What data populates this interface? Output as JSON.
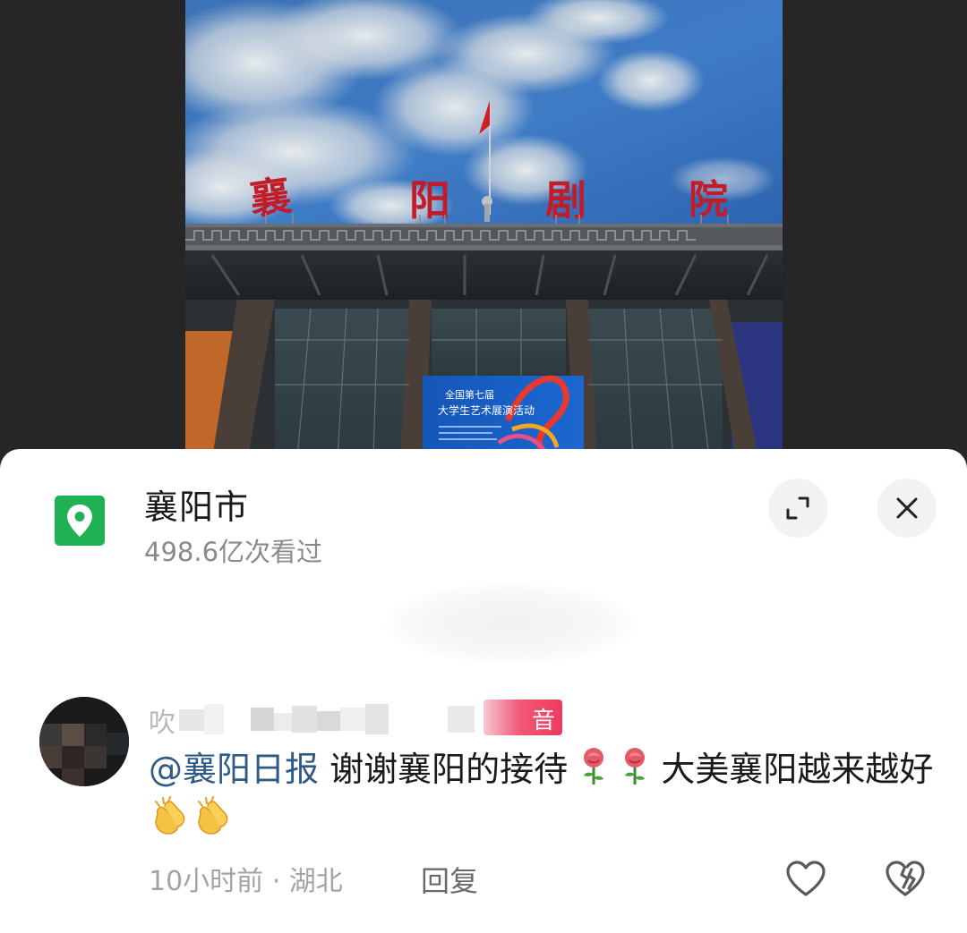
{
  "photo": {
    "banner_line1": "全国第七届",
    "banner_line2": "大学生艺术展演活动",
    "roof_sign": [
      "襄",
      "阳",
      "剧",
      "院"
    ]
  },
  "location": {
    "name": "襄阳市",
    "views": "498.6亿次看过",
    "icon": "location-pin-icon",
    "accent": "#1fb254"
  },
  "comment": {
    "user_prefix": "吹",
    "badge_char": "音",
    "mention": "@襄阳日报",
    "text_part1": " 谢谢襄阳的接待",
    "text_part2": " 大美襄阳越来越好",
    "emoji_after_text": [
      "rose-icon",
      "rose-icon"
    ],
    "emoji_end": [
      "clapping-hands-icon",
      "clapping-hands-icon"
    ],
    "time": "10小时前",
    "region": "湖北",
    "meta_separator": " · ",
    "reply_label": "回复",
    "mention_color": "#2f5a86"
  }
}
